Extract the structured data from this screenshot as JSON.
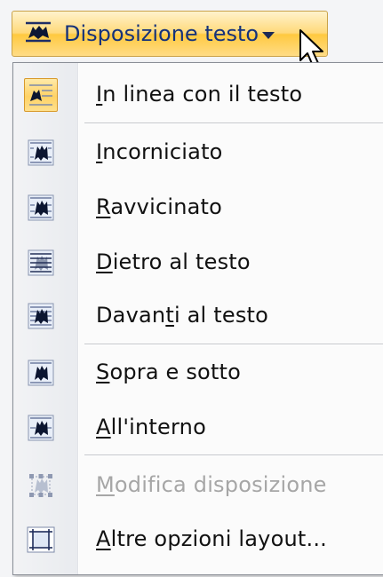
{
  "ribbon_button": {
    "label": "Disposizione testo",
    "icon": "wrap-text-icon"
  },
  "menu": {
    "items": [
      {
        "pre": "",
        "key": "I",
        "post": "n linea con il testo",
        "icon": "inline-with-text-icon",
        "state": "selected"
      },
      {
        "pre": "",
        "key": "I",
        "post": "ncorniciato",
        "icon": "square-wrap-icon",
        "state": "normal"
      },
      {
        "pre": "",
        "key": "R",
        "post": "avvicinato",
        "icon": "tight-wrap-icon",
        "state": "normal"
      },
      {
        "pre": "",
        "key": "D",
        "post": "ietro al testo",
        "icon": "behind-text-icon",
        "state": "normal"
      },
      {
        "pre": "Davan",
        "key": "t",
        "post": "i al testo",
        "icon": "in-front-of-text-icon",
        "state": "normal"
      },
      {
        "pre": "",
        "key": "S",
        "post": "opra e sotto",
        "icon": "top-bottom-icon",
        "state": "normal"
      },
      {
        "pre": "",
        "key": "A",
        "post": "ll'interno",
        "icon": "through-icon",
        "state": "normal"
      },
      {
        "pre": "",
        "key": "M",
        "post": "odifica disposizione",
        "icon": "edit-wrap-points-icon",
        "state": "disabled"
      },
      {
        "pre": "",
        "key": "A",
        "post": "ltre opzioni layout...",
        "icon": "more-layout-options-icon",
        "state": "normal"
      }
    ]
  },
  "colors": {
    "highlight": "#ffd265",
    "label_text": "#15327a",
    "disabled_text": "#a6a6a6"
  }
}
